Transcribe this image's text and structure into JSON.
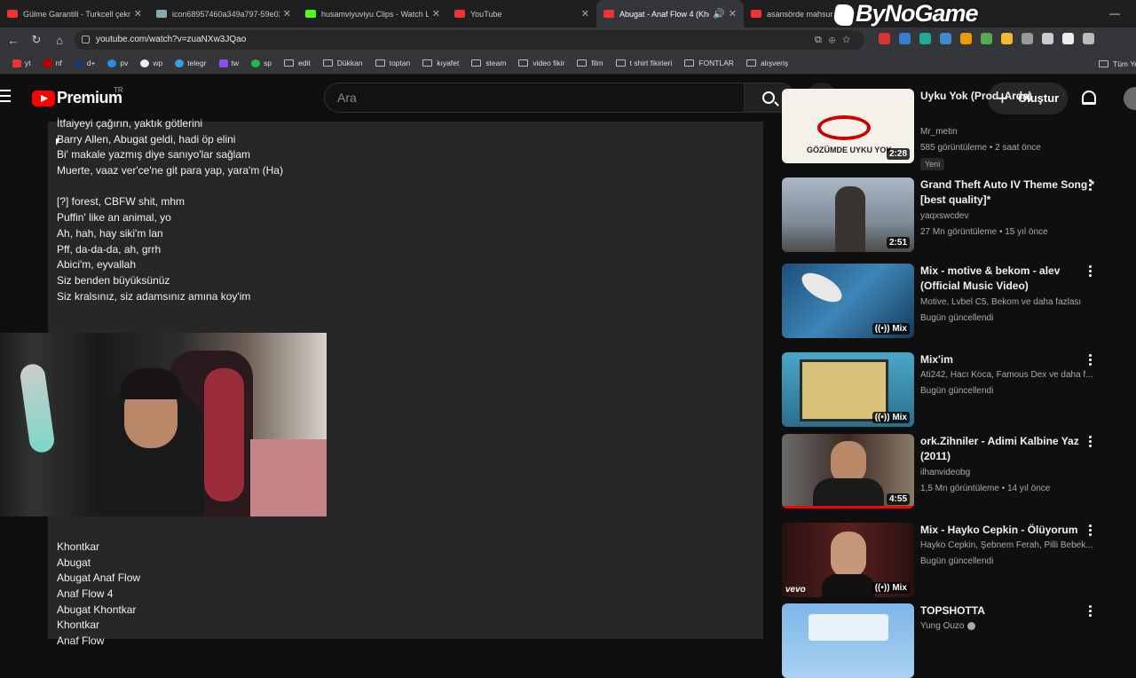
{
  "browser": {
    "tabs": [
      {
        "title": "Gülme Garantili - Turkcell çekm",
        "color": "#e33"
      },
      {
        "title": "icon68957460a349a797-59e02...",
        "color": "#8aa"
      },
      {
        "title": "husamviyuviyu Clips - Watch Li",
        "color": "#53fc18"
      },
      {
        "title": "YouTube",
        "color": "#e33"
      },
      {
        "title": "Abugat - Anaf Flow 4 (Khon",
        "color": "#e33"
      },
      {
        "title": "asansörde mahsur",
        "color": "#e33"
      }
    ],
    "watermark": "ByNoGame",
    "url": "youtube.com/watch?v=zuaNXw3JQao",
    "bookmarks": [
      "yt",
      "nf",
      "d+",
      "pv",
      "wp",
      "telegr",
      "tw",
      "sp",
      "edit",
      "Dükkan",
      "toptan",
      "kıyafet",
      "steam",
      "video fikir",
      "film",
      "t shirt fikirleri",
      "FONTLAR",
      "alışveriş",
      "Tüm Ye"
    ]
  },
  "youtube": {
    "logo_text": "Premium",
    "region": "TR",
    "search_placeholder": "Ara",
    "create_label": "Oluştur"
  },
  "description": {
    "lines_top": [
      "İtfaiyeyi çağırın, yaktık götlerini",
      "Barry Allen, Abugat geldi, hadi öp elini",
      "Bi' makale yazmış diye sanıyo'lar sağlam",
      "Muerte, vaaz ver'ce'ne git para yap, yara'm (Ha)",
      "",
      "[?] forest, CBFW shit, mhm",
      "Puffin' like an animal, yo",
      "Ah, hah, hay siki'm lan",
      "Pff, da-da-da, ah, grrh",
      "Abici'm, eyvallah",
      "Siz benden büyüksünüz",
      "Siz kralsınız, siz adamsınız amına koy'im"
    ],
    "lines_bottom": [
      "Khontkar",
      "Abugat",
      "Abugat Anaf Flow",
      "Anaf Flow 4",
      "Abugat Khontkar",
      "Khontkar",
      "Anaf Flow"
    ]
  },
  "recommendations": [
    {
      "title": "Uyku Yok (Prod. Arda)",
      "channel": "Mr_metin",
      "meta": "585 görüntüleme • 2 saat önce",
      "badge": "Yeni",
      "duration": "2:28",
      "thumb_text": "GÖZÜMDE UYKU YOK"
    },
    {
      "title": "Grand Theft Auto IV Theme Song *[best quality]*",
      "channel": "yaqxswcdev",
      "meta": "27 Mn görüntüleme • 15 yıl önce",
      "duration": "2:51"
    },
    {
      "title": "Mix - motive & bekom - alev (Official Music Video)",
      "channel": "Motive, Lvbel C5, Bekom ve daha fazlası",
      "meta": "Bugün güncellendi",
      "mix": "Mix"
    },
    {
      "title": "Mix'im",
      "channel": "Ati242, Hacı Koca, Famous Dex ve daha f...",
      "meta": "Bugün güncellendi",
      "mix": "Mix"
    },
    {
      "title": "ork.Zihniler - Adimi Kalbine Yaz (2011)",
      "channel": "ilhanvideobg",
      "meta": "1,5 Mn görüntüleme • 14 yıl önce",
      "duration": "4:55"
    },
    {
      "title": "Mix - Hayko Cepkin - Ölüyorum",
      "channel": "Hayko Cepkin, Şebnem Ferah, Pilli Bebek...",
      "meta": "Bugün güncellendi",
      "mix": "Mix",
      "thumb_text": "vevo"
    },
    {
      "title": "TOPSHOTTA",
      "channel": "Yung Ouzo",
      "meta": ""
    }
  ]
}
